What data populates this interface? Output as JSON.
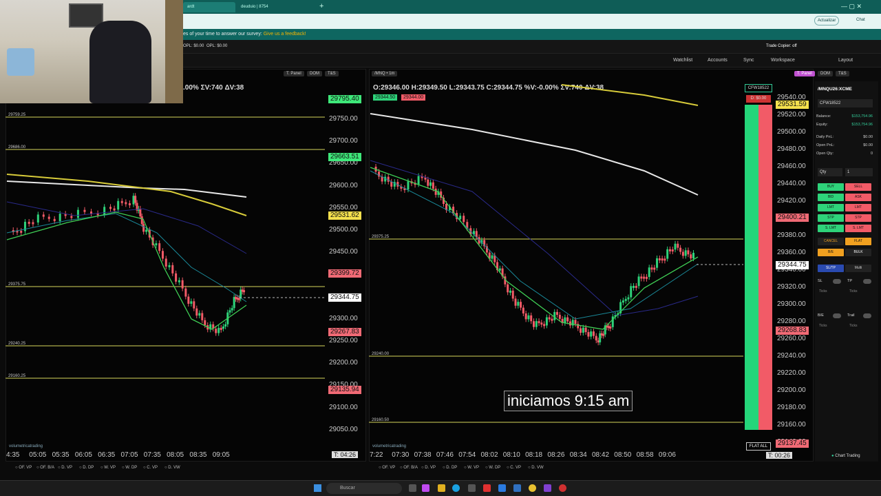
{
  "browser": {
    "tab1": "ardt",
    "tab2": "deuduio | 8754",
    "update": "Actualizar",
    "chat": "Chat"
  },
  "survey": {
    "text": "es of your time to answer our survey:",
    "link": "Give us a feedback!"
  },
  "topbar": {
    "opl": "OPL: $0.00",
    "opl2": "OPL: $0.00",
    "copier": "Trade Copier: off"
  },
  "nav": {
    "watchlist": "Watchlist",
    "accounts": "Accounts",
    "sync": "Sync",
    "workspace": "Workspace",
    "layout": "Layout"
  },
  "left_chart": {
    "header": {
      "tpanel": "T. Panel",
      "dom": "DOM",
      "ts": "T&S"
    },
    "ohlc": ".00% ΣV:740 ΔV:38",
    "levels": [
      {
        "label": "29759.25"
      },
      {
        "label": "29686.00"
      },
      {
        "label": "29375.75"
      },
      {
        "label": "29240.25"
      },
      {
        "label": "29160.25"
      }
    ],
    "prices": [
      "29750.00",
      "29700.00",
      "29650.00",
      "29600.00",
      "29550.00",
      "29500.00",
      "29450.00",
      "29400.00",
      "29350.00",
      "29300.00",
      "29250.00",
      "29200.00",
      "29150.00",
      "29100.00",
      "29050.00"
    ],
    "boxes": [
      {
        "text": "29795.40",
        "color": "#3ee87a"
      },
      {
        "text": "29663.51",
        "color": "#3ee87a"
      },
      {
        "text": "29531.62",
        "color": "#f4e04d"
      },
      {
        "text": "29399.72",
        "color": "#f06a75"
      },
      {
        "text": "29344.75",
        "color": "#ffffff"
      },
      {
        "text": "29267.83",
        "color": "#f06a75"
      },
      {
        "text": "29135.94",
        "color": "#f06a75"
      }
    ],
    "times": [
      "4:35",
      "05:05",
      "05:35",
      "06:05",
      "06:35",
      "07:05",
      "07:35",
      "08:05",
      "08:35",
      "09:05"
    ],
    "timer": "T: 04:26",
    "brand": "volumetricatrading"
  },
  "right_chart": {
    "symbol": "/MNQ • 1m",
    "header": {
      "tpanel": "T. Panel",
      "dom": "DOM",
      "ts": "T&S"
    },
    "ohlc": "O:29346.00  H:29349.50  L:29343.75  C:29344.75  %V:-0.00%  ΣV:740  ΔV:38",
    "bid": "29344.50",
    "ask": "29344.00",
    "levels": [
      {
        "label": "29375.25"
      },
      {
        "label": "29240.00"
      },
      {
        "label": "29160.50"
      }
    ],
    "prices": [
      "29540.00",
      "29520.00",
      "29500.00",
      "29480.00",
      "29460.00",
      "29440.00",
      "29420.00",
      "29400.00",
      "29380.00",
      "29360.00",
      "29340.00",
      "29320.00",
      "29300.00",
      "29280.00",
      "29260.00",
      "29240.00",
      "29220.00",
      "29200.00",
      "29180.00",
      "29160.00",
      "29140.00"
    ],
    "boxes": [
      {
        "text": "29531.59",
        "color": "#f4e04d"
      },
      {
        "text": "29400.21",
        "color": "#f06a75"
      },
      {
        "text": "29344.75",
        "color": "#ffffff"
      },
      {
        "text": "29268.83",
        "color": "#f06a75"
      },
      {
        "text": "29137.45",
        "color": "#f06a75"
      }
    ],
    "times": [
      "7:22",
      "07:30",
      "07:38",
      "07:46",
      "07:54",
      "08:02",
      "08:10",
      "08:18",
      "08:26",
      "08:34",
      "08:42",
      "08:50",
      "08:58",
      "09:06"
    ],
    "timer": "T: 00:26",
    "brand": "volumetricatrading",
    "account": "CFW18522",
    "pnl": "D: $0.00",
    "flat_all": "FLAT ALL"
  },
  "subtitle": "iniciamos 9:15 am",
  "order_panel": {
    "symbol": "/MNQU26:XCME",
    "account": "CFW18522",
    "rows": [
      {
        "k": "Balance:",
        "v": "$153,754.96"
      },
      {
        "k": "Equity:",
        "v": "$153,754.96"
      },
      {
        "k": "Daily PnL:",
        "v": "$0.00"
      },
      {
        "k": "Open PnL:",
        "v": "$0.00"
      },
      {
        "k": "Open Qty:",
        "v": "0"
      }
    ],
    "qty_label": "Qty",
    "qty": "1",
    "buttons": [
      [
        "BUY",
        "SELL"
      ],
      [
        "BID",
        "ASK"
      ],
      [
        "LMT",
        "LMT"
      ],
      [
        "STP",
        "STP"
      ],
      [
        "S. LMT",
        "S. LMT"
      ],
      [
        "CANCEL",
        "FLAT"
      ],
      [
        "B/E",
        "BULK"
      ]
    ],
    "sltp": "SL/TP",
    "multi": "Multi",
    "sl": "SL",
    "tp": "TP",
    "ticks": "Ticks",
    "be": "B/E",
    "trail": "Trail",
    "footer": "Chart Trading"
  },
  "bottom_tabs": [
    "OF. VP",
    "OF. B/A",
    "D. VP",
    "D. DP",
    "W. VP",
    "W. DP",
    "C. VP",
    "D. VW"
  ],
  "taskbar": {
    "search": "Buscar"
  },
  "colors": {
    "buy": "#2ed37a",
    "sell": "#f25b67",
    "level": "#d6d65a",
    "ema_green": "#3fcf55"
  }
}
